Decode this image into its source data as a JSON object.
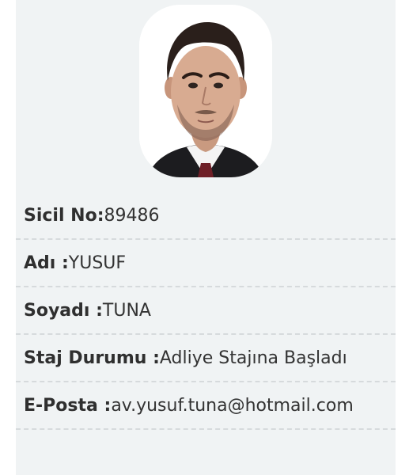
{
  "profile": {
    "photo_alt": "profile-photo",
    "fields": [
      {
        "label": "Sicil No:",
        "value": "89486"
      },
      {
        "label": "Adı :",
        "value": "YUSUF"
      },
      {
        "label": "Soyadı :",
        "value": "TUNA"
      },
      {
        "label": "Staj Durumu :",
        "value": "Adliye Stajına Başladı"
      },
      {
        "label": "E-Posta :",
        "value": "av.yusuf.tuna@hotmail.com"
      }
    ]
  },
  "colors": {
    "card_bg": "#f0f3f4",
    "divider": "#d6dadc",
    "text": "#333333"
  }
}
